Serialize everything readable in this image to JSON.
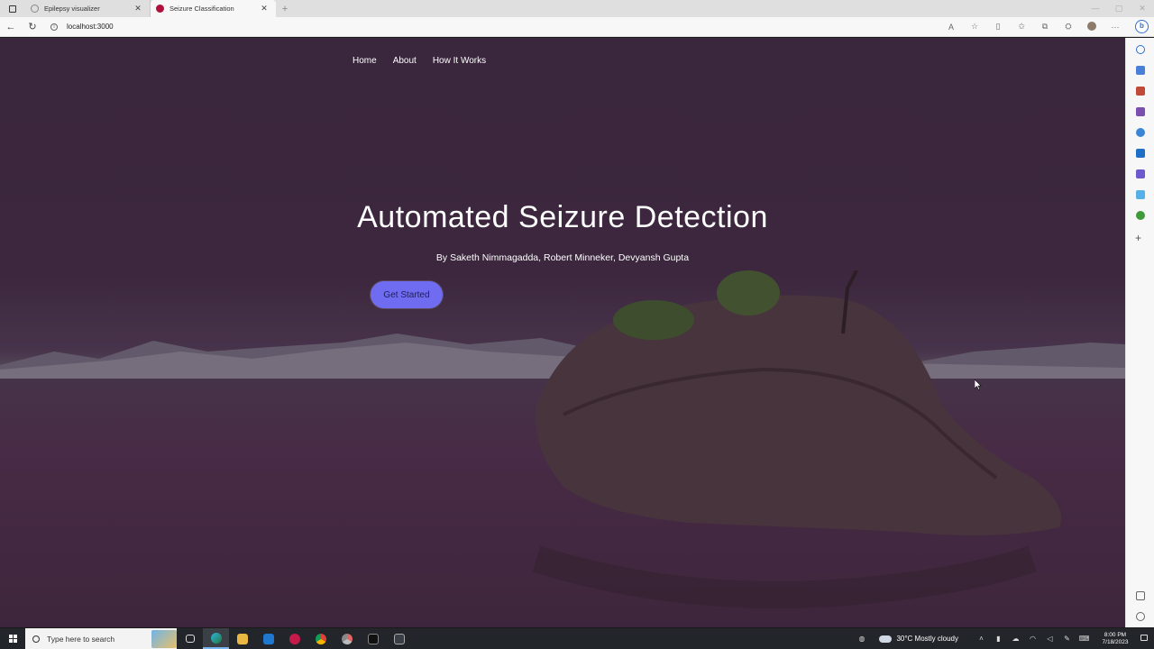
{
  "browser": {
    "tabs": [
      {
        "title": "Epilepsy visualizer",
        "active": false,
        "favicon_color": "#d9d9d9"
      },
      {
        "title": "Seizure Classification",
        "active": true,
        "favicon_color": "#b0123c"
      }
    ],
    "url": "localhost:3000"
  },
  "page": {
    "nav": [
      "Home",
      "About",
      "How It Works"
    ],
    "title": "Automated Seizure Detection",
    "authors": "By Saketh Nimmagadda, Robert Minneker, Devyansh Gupta",
    "cta_label": "Get Started",
    "colors": {
      "accent": "#6f6cf2",
      "overlay": "#3c2b3f"
    }
  },
  "taskbar": {
    "search_placeholder": "Type here to search",
    "weather": "30°C  Mostly cloudy",
    "time": "8:00 PM",
    "date": "7/18/2023"
  }
}
